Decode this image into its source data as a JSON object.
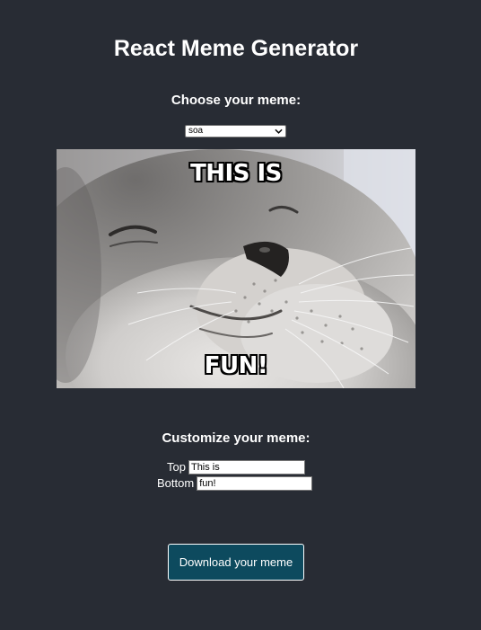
{
  "app": {
    "title": "React Meme Generator"
  },
  "chooser": {
    "label": "Choose your meme:",
    "selected": "soa"
  },
  "meme": {
    "top_text": "THIS IS",
    "bottom_text": "FUN!",
    "subject_icon": "smiling-seal"
  },
  "customize": {
    "label": "Customize your meme:",
    "top_label": "Top",
    "top_value": "This is",
    "bottom_label": "Bottom",
    "bottom_value": "fun!"
  },
  "download": {
    "label": "Download your meme",
    "color": "#0d4a5e"
  },
  "colors": {
    "background": "#282c34",
    "text": "#ffffff"
  }
}
